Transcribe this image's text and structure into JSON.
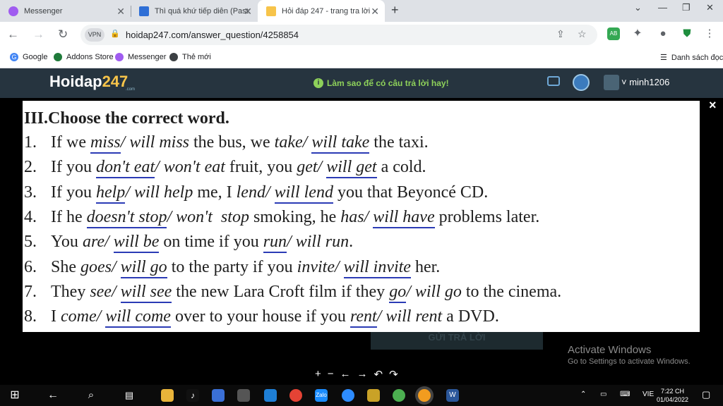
{
  "browser": {
    "tabs": [
      {
        "label": "Messenger",
        "active": false
      },
      {
        "label": "Thì quá khứ tiếp diễn (Past Co",
        "active": false
      },
      {
        "label": "Hỏi đáp 247 - trang tra lời",
        "active": true
      }
    ],
    "url": "hoidap247.com/answer_question/4258854",
    "vpn_label": "VPN",
    "bookmarks": [
      "Google",
      "Addons Store",
      "Messenger",
      "Thẻ mới"
    ],
    "reading_list": "Danh sách đọc"
  },
  "site": {
    "logo_main": "Hoidap",
    "logo_num": "247",
    "logo_sub": ".com",
    "tip": "Làm sao để có câu trả lời hay!",
    "username": "minh1206",
    "submit_button": "GỬI TRẢ LỜI"
  },
  "exercise": {
    "heading": "III.Choose the correct word.",
    "lines": [
      {
        "num": "1.",
        "parts": [
          [
            "t",
            "If we "
          ],
          [
            "a",
            "miss"
          ],
          [
            "i",
            "/ will miss"
          ],
          [
            "t",
            " the bus, we "
          ],
          [
            "i",
            "take/ "
          ],
          [
            "a",
            "will take"
          ],
          [
            "t",
            " the taxi."
          ]
        ]
      },
      {
        "num": "2.",
        "parts": [
          [
            "t",
            "If you "
          ],
          [
            "a",
            "don't eat"
          ],
          [
            "i",
            "/ won't eat"
          ],
          [
            "t",
            " fruit, you "
          ],
          [
            "i",
            "get/ "
          ],
          [
            "a",
            "will get"
          ],
          [
            "t",
            " a cold."
          ]
        ]
      },
      {
        "num": "3.",
        "parts": [
          [
            "t",
            "If you "
          ],
          [
            "a",
            "help"
          ],
          [
            "i",
            "/ will help"
          ],
          [
            "t",
            " me, I "
          ],
          [
            "i",
            "lend/ "
          ],
          [
            "a",
            "will lend"
          ],
          [
            "t",
            " you that Beyoncé CD."
          ]
        ]
      },
      {
        "num": "4.",
        "parts": [
          [
            "t",
            "If he "
          ],
          [
            "a",
            "doesn't stop"
          ],
          [
            "i",
            "/ won't  stop"
          ],
          [
            "t",
            " smoking, he "
          ],
          [
            "i",
            "has/ "
          ],
          [
            "a",
            "will have"
          ],
          [
            "t",
            " problems later."
          ]
        ]
      },
      {
        "num": "5.",
        "parts": [
          [
            "t",
            "You "
          ],
          [
            "i",
            "are/ "
          ],
          [
            "a",
            "will be"
          ],
          [
            "t",
            " on time if you "
          ],
          [
            "a",
            "run"
          ],
          [
            "i",
            "/ will run"
          ],
          [
            "t",
            "."
          ]
        ]
      },
      {
        "num": "6.",
        "parts": [
          [
            "t",
            "She "
          ],
          [
            "i",
            "goes/ "
          ],
          [
            "a",
            "will go"
          ],
          [
            "t",
            " to the party if you "
          ],
          [
            "i",
            "invite/ "
          ],
          [
            "a",
            "will invite"
          ],
          [
            "t",
            " her."
          ]
        ]
      },
      {
        "num": "7.",
        "parts": [
          [
            "t",
            "They "
          ],
          [
            "i",
            "see/ "
          ],
          [
            "a",
            "will see"
          ],
          [
            "t",
            " the new Lara Croft film if they "
          ],
          [
            "a",
            "go"
          ],
          [
            "i",
            "/ will go"
          ],
          [
            "t",
            " to the cinema."
          ]
        ]
      },
      {
        "num": "8.",
        "parts": [
          [
            "t",
            "I "
          ],
          [
            "i",
            "come/ "
          ],
          [
            "a",
            "will come"
          ],
          [
            "t",
            " over to your house if you "
          ],
          [
            "a",
            "rent"
          ],
          [
            "i",
            "/ will rent"
          ],
          [
            "t",
            " a DVD."
          ]
        ]
      }
    ]
  },
  "viewer_controls": [
    "+",
    "−",
    "←",
    "→",
    "↶",
    "↷"
  ],
  "close_symbol": "×",
  "windows_notice": {
    "title": "Activate Windows",
    "subtitle": "Go to Settings to activate Windows."
  },
  "taskbar": {
    "language": "VIE",
    "time": "7:22 CH",
    "date": "01/04/2022"
  },
  "colors": {
    "site_header": "#26343f",
    "answer_underline": "#2b3bb5",
    "tip_green": "#8ed15a"
  }
}
